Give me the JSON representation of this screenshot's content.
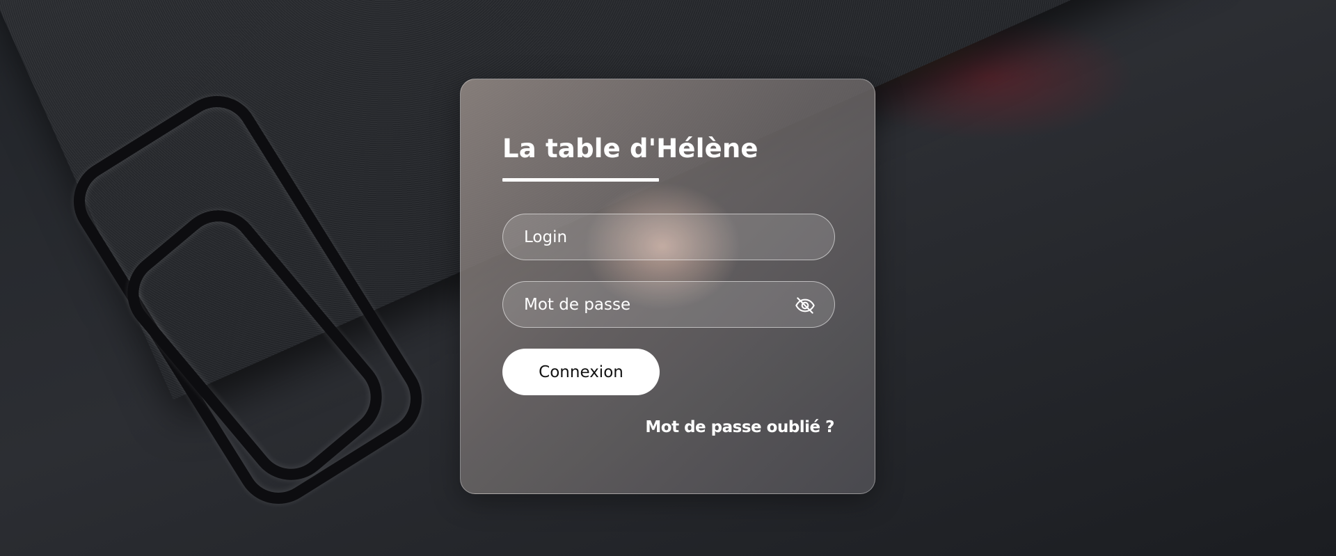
{
  "login_card": {
    "title": "La table d'Hélène",
    "login_field": {
      "value": "",
      "placeholder": "Login"
    },
    "password_field": {
      "value": "",
      "placeholder": "Mot de passe",
      "toggle_icon": "eye-slash-icon"
    },
    "submit_label": "Connexion",
    "forgot_password_label": "Mot de passe oublié ?"
  },
  "colors": {
    "button_background": "#ffffff",
    "button_text": "#111111",
    "text": "#ffffff"
  }
}
